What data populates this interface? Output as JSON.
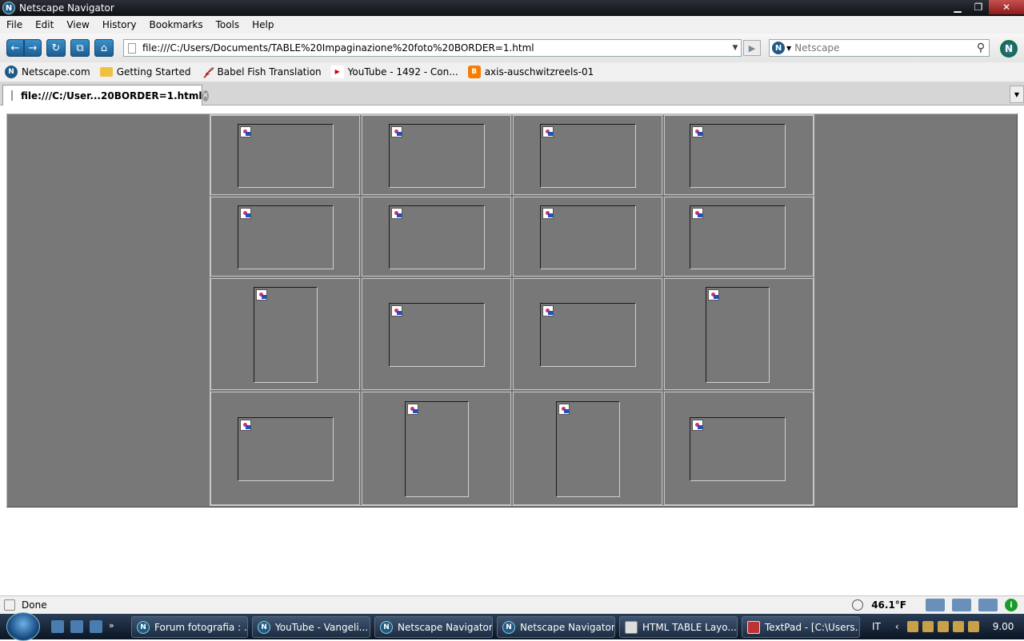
{
  "window": {
    "title": "Netscape Navigator",
    "app_icon": "N",
    "close_glyph": "✕",
    "max_glyph": "❐",
    "min_glyph": "▁"
  },
  "menu": [
    "File",
    "Edit",
    "View",
    "History",
    "Bookmarks",
    "Tools",
    "Help"
  ],
  "nav": {
    "back_glyph": "←",
    "forward_glyph": "→",
    "reload_glyph": "↻",
    "stop_glyph": "⧉",
    "home_glyph": "⌂",
    "url": "file:///C:/Users/Documents/TABLE%20Impaginazione%20foto%20BORDER=1.html",
    "go_glyph": "▶",
    "search_engine": "N",
    "search_placeholder": "Netscape",
    "logo": "N"
  },
  "bookmarks": [
    {
      "label": "Netscape.com",
      "icon": "netscape-icon"
    },
    {
      "label": "Getting Started",
      "icon": "folder-icon"
    },
    {
      "label": "Babel Fish Translation",
      "icon": "babel-fish-icon"
    },
    {
      "label": "YouTube - 1492 - Con...",
      "icon": "youtube-icon"
    },
    {
      "label": "axis-auschwitzreels-01",
      "icon": "blogger-icon"
    }
  ],
  "tab": {
    "label": "file:///C:/User...20BORDER=1.html",
    "close_glyph": "×"
  },
  "status": {
    "text": "Done",
    "temperature": "46.1°F",
    "info_glyph": "i"
  },
  "taskbar": {
    "buttons": [
      {
        "label": "Forum fotografia : ...",
        "icon": "N"
      },
      {
        "label": "YouTube - Vangeli...",
        "icon": "N"
      },
      {
        "label": "Netscape Navigator",
        "icon": "N"
      },
      {
        "label": "Netscape Navigator",
        "icon": "N"
      },
      {
        "label": "HTML TABLE Layo...",
        "icon": ""
      },
      {
        "label": "TextPad - [C:\\Users...",
        "icon": ""
      }
    ],
    "lang": "IT",
    "clock": "9.00"
  },
  "colors": {
    "page_bg": "#787878",
    "cell_border": "#c8c8c8",
    "accent": "#1a5d92"
  }
}
